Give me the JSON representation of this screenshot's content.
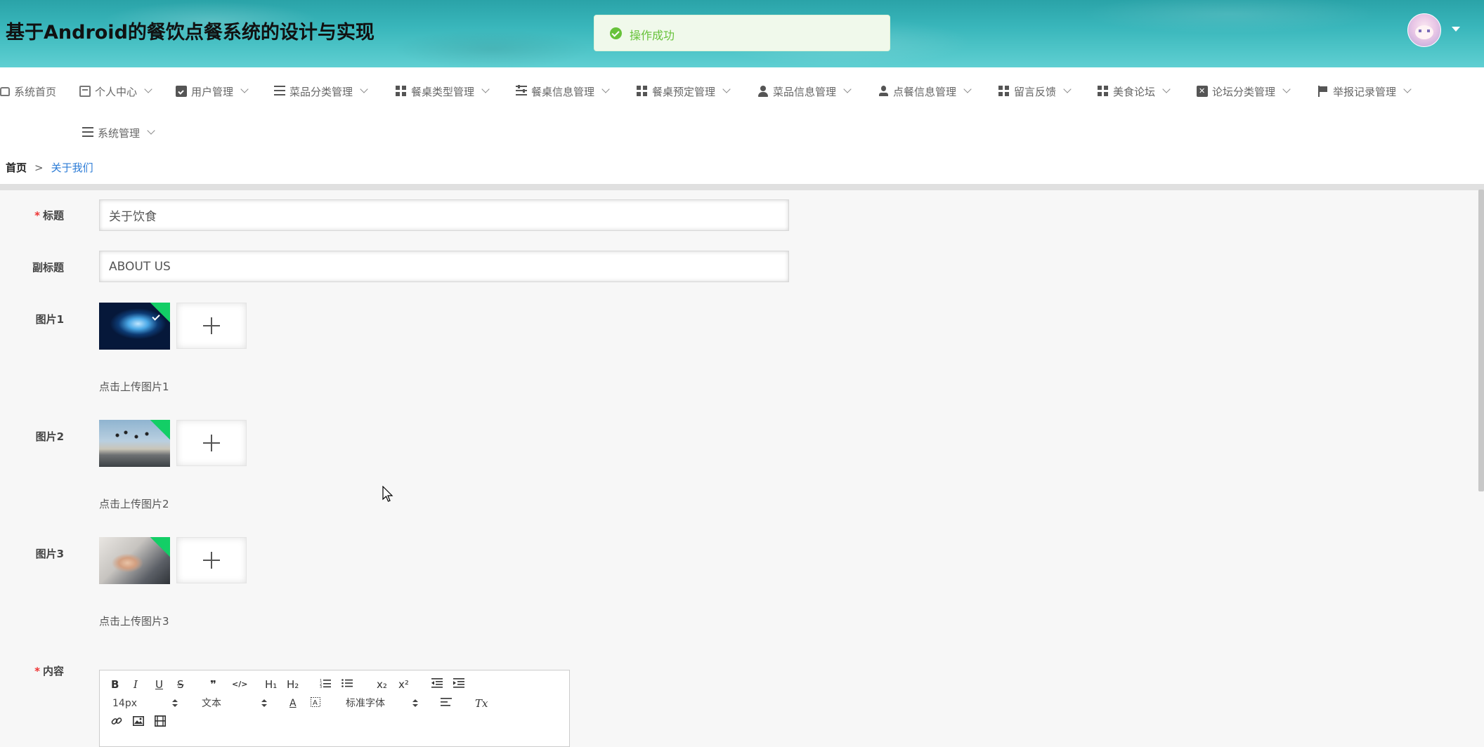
{
  "header": {
    "title": "基于Android的餐饮点餐系统的设计与实现",
    "toast": "操作成功",
    "brand_color": "#3ab5b9"
  },
  "nav": {
    "items": [
      {
        "label": "系统首页",
        "icon": "home-icon"
      },
      {
        "label": "个人中心",
        "icon": "card-icon"
      },
      {
        "label": "用户管理",
        "icon": "clipboard-check-icon"
      },
      {
        "label": "菜品分类管理",
        "icon": "lines-icon"
      },
      {
        "label": "餐桌类型管理",
        "icon": "grid-icon"
      },
      {
        "label": "餐桌信息管理",
        "icon": "sliders-icon"
      },
      {
        "label": "餐桌预定管理",
        "icon": "grid-icon"
      },
      {
        "label": "菜品信息管理",
        "icon": "user-icon"
      },
      {
        "label": "点餐信息管理",
        "icon": "user-icon"
      },
      {
        "label": "留言反馈",
        "icon": "grid-icon"
      },
      {
        "label": "美食论坛",
        "icon": "grid-icon"
      },
      {
        "label": "论坛分类管理",
        "icon": "clipboard-x-icon"
      },
      {
        "label": "举报记录管理",
        "icon": "flag-icon"
      },
      {
        "label": "系统管理",
        "icon": "menu-icon"
      }
    ]
  },
  "breadcrumb": {
    "home": "首页",
    "separator": ">",
    "current": "关于我们"
  },
  "form": {
    "title_label": "标题",
    "title_value": "关于饮食",
    "subtitle_label": "副标题",
    "subtitle_value": "ABOUT US",
    "images": [
      {
        "label": "图片1",
        "hint": "点击上传图片1"
      },
      {
        "label": "图片2",
        "hint": "点击上传图片2"
      },
      {
        "label": "图片3",
        "hint": "点击上传图片3"
      }
    ],
    "content_label": "内容",
    "required_mark": "*"
  },
  "editor": {
    "bold": "B",
    "italic": "I",
    "underline": "U",
    "strike": "S",
    "quote": "❞",
    "code": "</>",
    "h1": "H₁",
    "h2": "H₂",
    "sub": "x₂",
    "sup": "x²",
    "font_size": "14px",
    "header_select": "文本",
    "font_family": "标准字体",
    "color_letter": "A",
    "clean": "Tx"
  },
  "colors": {
    "success": "#67c23a",
    "required": "#e33333",
    "link": "#2b7bd6",
    "upload_badge": "#13ce66"
  }
}
